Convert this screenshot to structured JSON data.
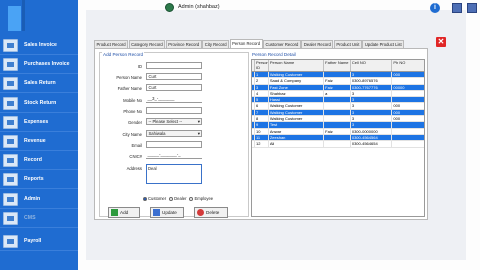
{
  "titlebar": {
    "admin_label": "Admin (shahbaz)",
    "info_glyph": "i"
  },
  "sidebar": {
    "items": [
      {
        "label": "Sales Invoice",
        "icon": "invoice-icon",
        "active": false,
        "disabled": false
      },
      {
        "label": "Purchases Invoice",
        "icon": "purchase-icon",
        "active": false,
        "disabled": false
      },
      {
        "label": "Sales Return",
        "icon": "sales-return-icon",
        "active": false,
        "disabled": false
      },
      {
        "label": "Stock Return",
        "icon": "stock-return-icon",
        "active": false,
        "disabled": false
      },
      {
        "label": "Expenses",
        "icon": "expenses-icon",
        "active": false,
        "disabled": false
      },
      {
        "label": "Revenue",
        "icon": "revenue-icon",
        "active": false,
        "disabled": false
      },
      {
        "label": "Record",
        "icon": "record-icon",
        "active": false,
        "disabled": false
      },
      {
        "label": "Reports",
        "icon": "reports-icon",
        "active": false,
        "disabled": false
      },
      {
        "label": "Admin",
        "icon": "admin-icon",
        "active": false,
        "disabled": false
      },
      {
        "label": "CMS",
        "icon": "cms-icon",
        "active": false,
        "disabled": true
      },
      {
        "label": "Payroll",
        "icon": "payroll-icon",
        "active": false,
        "disabled": false
      }
    ]
  },
  "tabs": [
    {
      "label": "Product Record",
      "active": false
    },
    {
      "label": "Category Record",
      "active": false
    },
    {
      "label": "Province Record",
      "active": false
    },
    {
      "label": "City Record",
      "active": false
    },
    {
      "label": "Person Record",
      "active": true
    },
    {
      "label": "Customer Record",
      "active": false
    },
    {
      "label": "Dealer Record",
      "active": false
    },
    {
      "label": "Product Unit",
      "active": false
    },
    {
      "label": "Update Product List",
      "active": false
    }
  ],
  "form": {
    "title": "Add Person Record",
    "fields": [
      {
        "label": "ID",
        "value": "",
        "type": "text"
      },
      {
        "label": "Person Name",
        "value": "Curt",
        "type": "text"
      },
      {
        "label": "Father Name",
        "value": "Curt",
        "type": "text"
      },
      {
        "label": "Mobile No",
        "value": "__3_-_______",
        "type": "masked"
      },
      {
        "label": "Phone No",
        "value": "",
        "type": "text"
      },
      {
        "label": "Gender",
        "value": "-- Please Select --",
        "type": "select"
      },
      {
        "label": "City Name",
        "value": "Sahiwala",
        "type": "select"
      },
      {
        "label": "Email",
        "value": "",
        "type": "text"
      },
      {
        "label": "CNIC#",
        "value": "_____-_______-_",
        "type": "masked"
      },
      {
        "label": "Address",
        "value": "Deal",
        "type": "textarea"
      }
    ],
    "radios": [
      {
        "label": "Customer",
        "checked": true
      },
      {
        "label": "Dealer",
        "checked": false
      },
      {
        "label": "Employee",
        "checked": false
      }
    ],
    "buttons": {
      "add": "Add",
      "update": "Update",
      "delete": "Delete"
    }
  },
  "detail": {
    "title": "Person Record Detail",
    "columns": [
      "Person ID",
      "Person Name",
      "Father Name",
      "Cell NO",
      "Ph NO"
    ],
    "rows": [
      {
        "id": "1",
        "name": "Walking Customer",
        "father": "",
        "cell": "3",
        "ph": "000",
        "selected": true
      },
      {
        "id": "2",
        "name": "Saad & Company",
        "father": "Faiz",
        "cell": "0300-8976576",
        "ph": "",
        "selected": false
      },
      {
        "id": "3",
        "name": "Fast Zone",
        "father": "Faiz",
        "cell": "0300-7767776",
        "ph": "00000",
        "selected": true
      },
      {
        "id": "4",
        "name": "Shahbaz",
        "father": "a",
        "cell": "3",
        "ph": "",
        "selected": false
      },
      {
        "id": "5",
        "name": "Hassi",
        "father": "",
        "cell": "3",
        "ph": "",
        "selected": true
      },
      {
        "id": "6",
        "name": "Walking Customer",
        "father": "",
        "cell": "3",
        "ph": "000",
        "selected": false
      },
      {
        "id": "7",
        "name": "Walking Customer",
        "father": "",
        "cell": "3",
        "ph": "000",
        "selected": true
      },
      {
        "id": "8",
        "name": "Walking Customer",
        "father": "",
        "cell": "3",
        "ph": "000",
        "selected": false
      },
      {
        "id": "9",
        "name": "Test",
        "father": "",
        "cell": "3",
        "ph": "",
        "selected": true
      },
      {
        "id": "10",
        "name": "Anwar",
        "father": "Faiz",
        "cell": "0300-0000000",
        "ph": "",
        "selected": false
      },
      {
        "id": "11",
        "name": "Zeeshan",
        "father": "",
        "cell": "0300-4564564",
        "ph": "",
        "selected": true
      },
      {
        "id": "12",
        "name": "Ali",
        "father": "",
        "cell": "0300-4564654",
        "ph": "",
        "selected": false
      }
    ]
  },
  "colors": {
    "sidebar": "#1f6cd1",
    "selection": "#1d74e4",
    "close": "#e02626"
  }
}
